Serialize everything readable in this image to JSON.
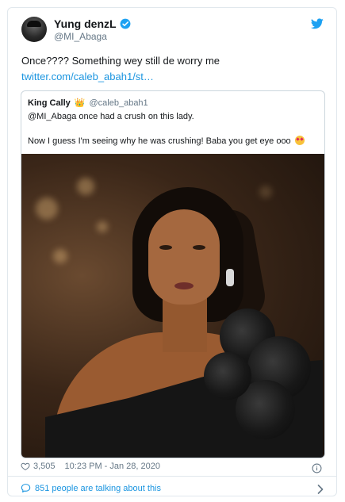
{
  "author": {
    "display_name": "Yung denzL",
    "handle": "@MI_Abaga",
    "verified": true
  },
  "tweet": {
    "text": "Once???? Something wey still de worry me",
    "link_text": "twitter.com/caleb_abah1/st…"
  },
  "quoted": {
    "name": "King Cally",
    "crown_emoji": "👑",
    "handle": "@caleb_abah1",
    "line1": "@MI_Abaga once had a crush on this lady.",
    "line2": "Now I guess I'm seeing why he was crushing! Baba you get eye ooo"
  },
  "footer": {
    "likes": "3,505",
    "timestamp": "10:23 PM - Jan 28, 2020"
  },
  "conversation": {
    "text": "851 people are talking about this"
  },
  "icons": [
    "verified-icon",
    "twitter-bird-icon",
    "heart-icon",
    "info-icon",
    "speech-bubble-icon",
    "chevron-right-icon",
    "star-struck-emoji"
  ],
  "colors": {
    "accent": "#1b95e0",
    "secondary_text": "#657786",
    "border": "#e1e8ed"
  }
}
